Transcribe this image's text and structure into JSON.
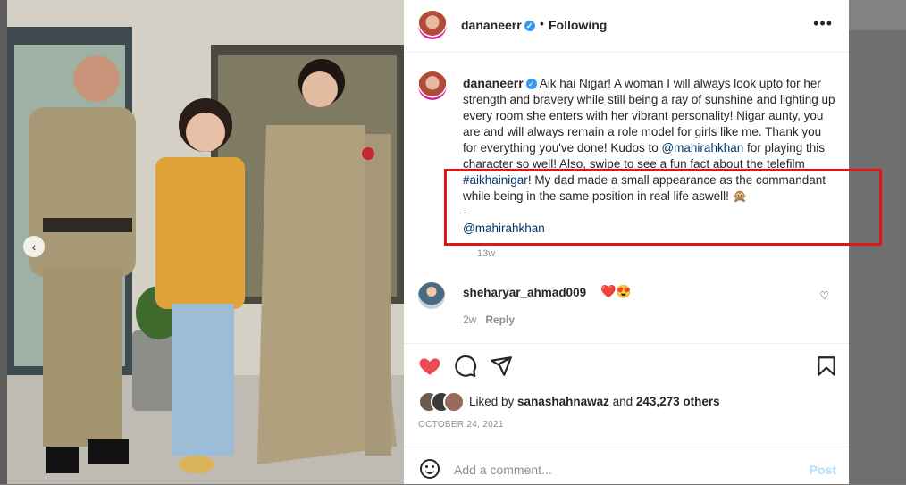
{
  "post": {
    "username": "dananeerr",
    "follow_status": "Following",
    "more_label": "•••",
    "caption_parts": {
      "intro": "Aik hai Nigar! A woman I will always look upto for her strength and bravery while still being a ray of sunshine and lighting up every room she enters with her vibrant personality! Nigar aunty, you are and will always remain a role model for girls like me. Thank you for everything you've done! Kudos to ",
      "mention1": "@mahirahkhan",
      "middle": " for playing this character so well! Also, swipe to see a fun fact about the telefilm ",
      "hashtag": "#aikhainigar",
      "after": "! My dad made a small appearance as the commandant while being in the same position in real life aswell! 🙊",
      "dash": "-",
      "mention2": "@mahirahkhan"
    },
    "caption_age": "13w"
  },
  "comment": {
    "username": "sheharyar_ahmad009",
    "emojis": "❤️😍",
    "age": "2w",
    "reply_label": "Reply"
  },
  "likes": {
    "prefix": "Liked by ",
    "user": "sanashahnawaz",
    "middle": " and ",
    "count": "243,273 others"
  },
  "date": "OCTOBER 24, 2021",
  "add_comment": {
    "placeholder": "Add a comment...",
    "post_label": "Post"
  },
  "colors": {
    "highlight_box": "#e0141b",
    "like_red": "#ed4956",
    "link": "#00376b"
  },
  "icons": [
    "like-heart-icon",
    "comment-icon",
    "share-icon",
    "save-icon",
    "emoji-icon",
    "verified-icon",
    "more-options-icon",
    "comment-like-icon",
    "carousel-prev-icon"
  ]
}
